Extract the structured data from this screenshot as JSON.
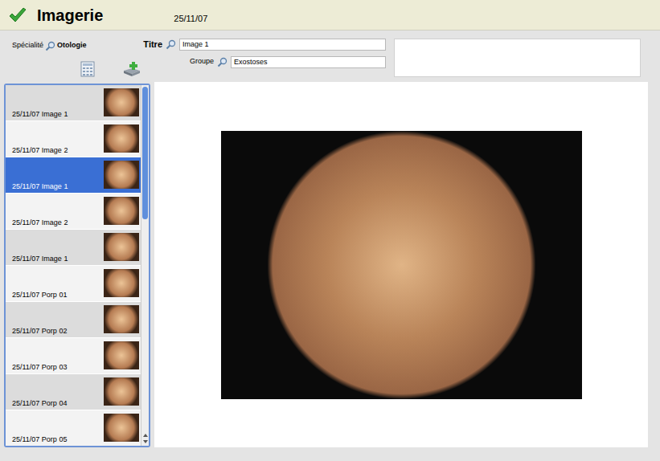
{
  "header": {
    "title": "Imagerie",
    "date": "25/11/07"
  },
  "form": {
    "specialite_label": "Spécialité",
    "specialite": "Otologie",
    "titre_label": "Titre",
    "titre": "Image 1",
    "groupe_label": "Groupe",
    "groupe": "Exostoses"
  },
  "images": [
    {
      "label": "25/11/07 Image 1",
      "selected": false
    },
    {
      "label": "25/11/07 Image 2",
      "selected": false
    },
    {
      "label": "25/11/07 Image 1",
      "selected": true
    },
    {
      "label": "25/11/07 Image 2",
      "selected": false
    },
    {
      "label": "25/11/07 Image 1",
      "selected": false
    },
    {
      "label": "25/11/07 Porp 01",
      "selected": false
    },
    {
      "label": "25/11/07 Porp 02",
      "selected": false
    },
    {
      "label": "25/11/07 Porp 03",
      "selected": false
    },
    {
      "label": "25/11/07 Porp 04",
      "selected": false
    },
    {
      "label": "25/11/07 Porp 05",
      "selected": false
    }
  ]
}
